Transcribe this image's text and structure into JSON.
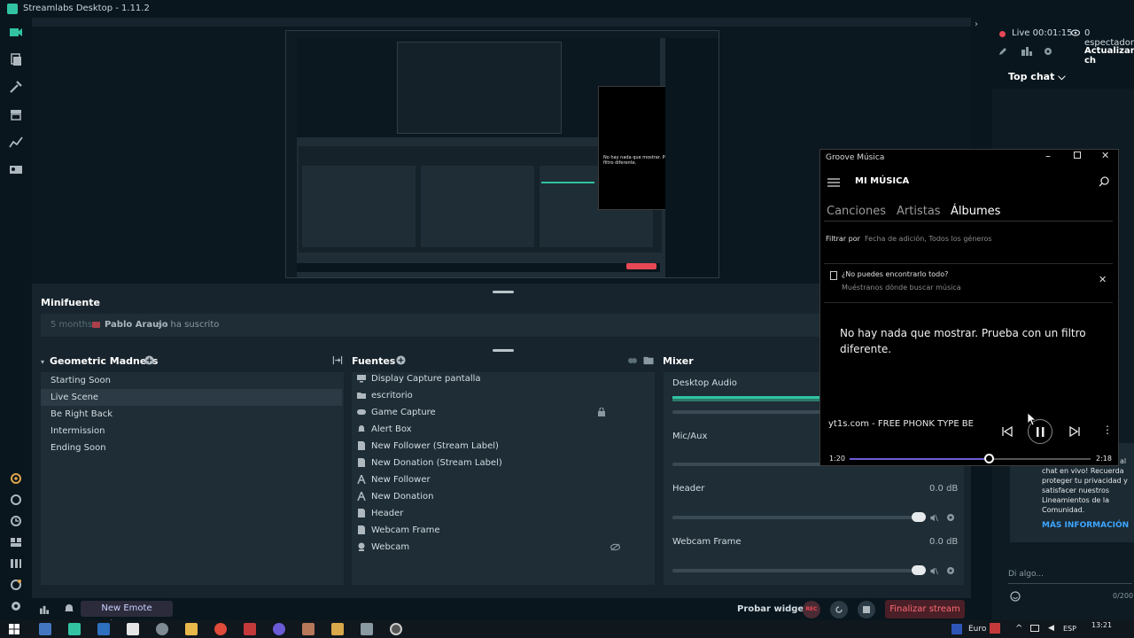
{
  "app": {
    "title": "Streamlabs Desktop - 1.11.2"
  },
  "minifuente": {
    "title": "Minifuente",
    "event": {
      "time": "5 months",
      "user": "Pablo Araujo",
      "action": "se ha suscrito"
    }
  },
  "scenes": {
    "title": "Geometric Madness",
    "items": [
      "Starting Soon",
      "Live Scene",
      "Be Right Back",
      "Intermission",
      "Ending Soon"
    ],
    "selected_index": 1
  },
  "sources": {
    "title": "Fuentes",
    "items": [
      {
        "label": "Display Capture pantalla",
        "icon": "monitor-icon"
      },
      {
        "label": "escritorio",
        "icon": "folder-icon"
      },
      {
        "label": "Game Capture",
        "icon": "gamepad-icon"
      },
      {
        "label": "Alert Box",
        "icon": "bell-icon"
      },
      {
        "label": "New Follower (Stream Label)",
        "icon": "file-icon"
      },
      {
        "label": "New Donation (Stream Label)",
        "icon": "file-icon"
      },
      {
        "label": "New Follower",
        "icon": "text-icon"
      },
      {
        "label": "New Donation",
        "icon": "text-icon"
      },
      {
        "label": "Header",
        "icon": "file-icon"
      },
      {
        "label": "Webcam Frame",
        "icon": "file-icon"
      },
      {
        "label": "Webcam",
        "icon": "webcam-icon"
      }
    ]
  },
  "mixer": {
    "title": "Mixer",
    "channels": [
      {
        "name": "Desktop Audio",
        "db": "",
        "level": 0.42
      },
      {
        "name": "Mic/Aux",
        "db": "",
        "level": 0.0
      },
      {
        "name": "Header",
        "db": "0.0 dB",
        "level": 0.0
      },
      {
        "name": "Webcam Frame",
        "db": "0.0 dB",
        "level": 0.0
      }
    ]
  },
  "statusbar": {
    "widget_label": "New Emote Giveaway!",
    "test_widgets": "Probar widgets",
    "rec": "REC",
    "end_stream": "Finalizar stream"
  },
  "chat": {
    "live_time": "Live 00:01:15",
    "viewers": "0 espectador",
    "refresh": "Actualizar ch",
    "top_chat": "Top chat",
    "notice_snippet": "al",
    "notice_lines": [
      "chat en vivo! Recuerda",
      "proteger tu privacidad y",
      "satisfacer nuestros",
      "Lineamientos de la",
      "Comunidad."
    ],
    "more_info": "MÁS INFORMACIÓN",
    "input_placeholder": "Di algo...",
    "char_count": "0/200"
  },
  "groove": {
    "window_title": "Groove Música",
    "heading": "MI MÚSICA",
    "tabs": [
      "Canciones",
      "Artistas",
      "Álbumes"
    ],
    "active_tab": 2,
    "filter_label": "Filtrar por",
    "filter_value": "Fecha de adición, Todos los géneros",
    "tip_title": "¿No puedes encontrarlo todo?",
    "tip_subtitle": "Muéstranos dónde buscar música",
    "empty_message_line1": "No hay nada que mostrar. Prueba con un filtro",
    "empty_message_line2": "diferente.",
    "now_playing": "yt1s.com - FREE PHONK TYPE BE",
    "time_elapsed": "1:20",
    "time_total": "2:18",
    "progress": 0.58
  },
  "taskbar": {
    "currency": "Euro",
    "lang": "ESP",
    "time": "13:21"
  },
  "colors": {
    "accent": "#31c3a2",
    "danger": "#e84855",
    "groove_accent": "#6d5ed6"
  }
}
